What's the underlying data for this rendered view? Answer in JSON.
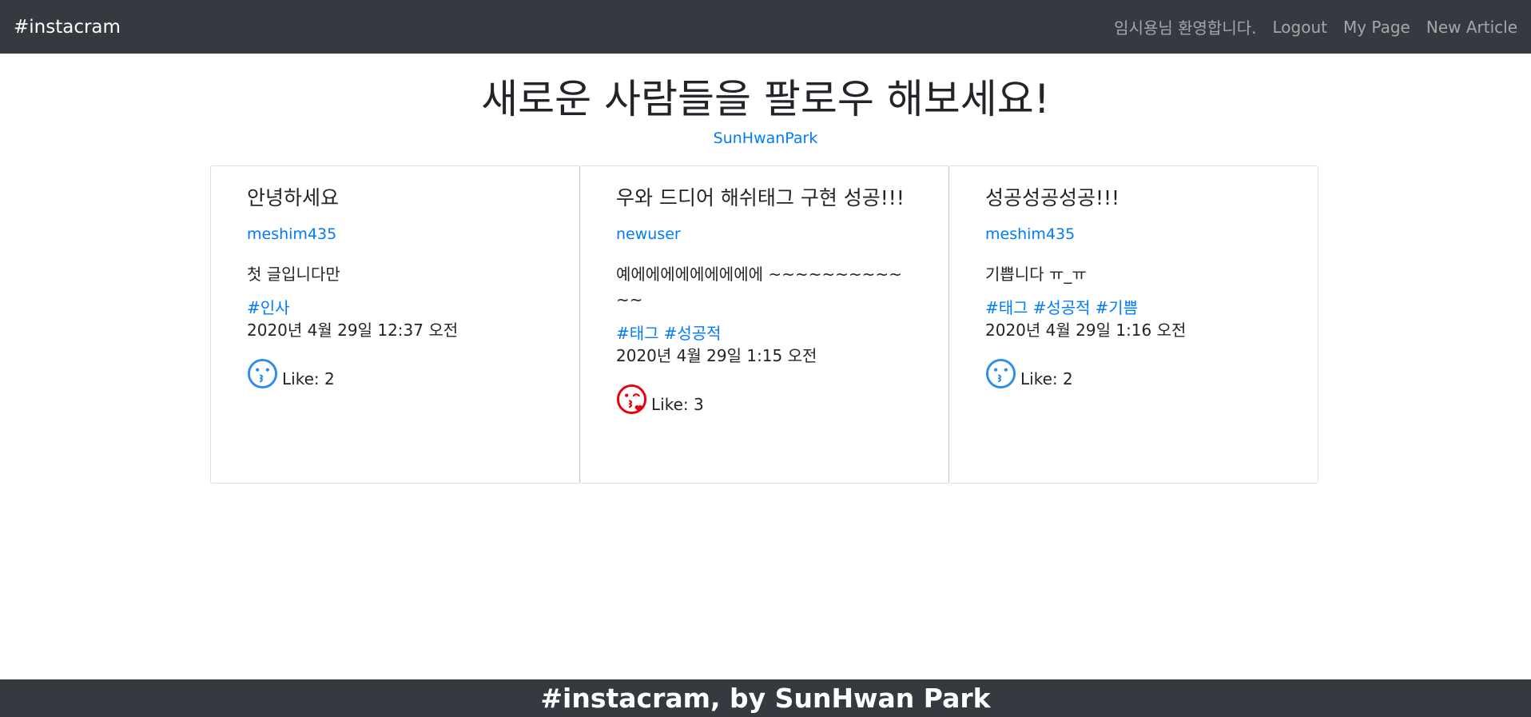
{
  "navbar": {
    "brand": "#instacram",
    "welcome": "임시용님 환영합니다.",
    "logout": "Logout",
    "my_page": "My Page",
    "new_article": "New Article"
  },
  "header": {
    "title": "새로운 사람들을 팔로우 해보세요!",
    "user_link": "SunHwanPark"
  },
  "articles": [
    {
      "title": "안녕하세요",
      "author": "meshim435",
      "body": "첫 글입니다만",
      "tags": [
        "#인사"
      ],
      "date": "2020년 4월 29일 12:37 오전",
      "like_label": "Like: 2",
      "liked": false
    },
    {
      "title": "우와 드디어 해쉬태그 구현 성공!!!",
      "author": "newuser",
      "body": "예에에에에에에에에에 ~~~~~~~~~~~~",
      "tags": [
        "#태그",
        "#성공적"
      ],
      "date": "2020년 4월 29일 1:15 오전",
      "like_label": "Like: 3",
      "liked": true
    },
    {
      "title": "성공성공성공!!!",
      "author": "meshim435",
      "body": "기쁩니다 ㅠ_ㅠ",
      "tags": [
        "#태그",
        "#성공적",
        "#기쁨"
      ],
      "date": "2020년 4월 29일 1:16 오전",
      "like_label": "Like: 2",
      "liked": false
    }
  ],
  "footer": {
    "text": "#instacram, by SunHwan Park"
  },
  "colors": {
    "navbar_bg": "#343a40",
    "link": "#007bff",
    "like_off": "#2d8cf0",
    "like_on": "#e8000b"
  },
  "icons": {
    "like_off": "kissing-face-icon",
    "like_on": "kissing-face-heart-icon"
  }
}
